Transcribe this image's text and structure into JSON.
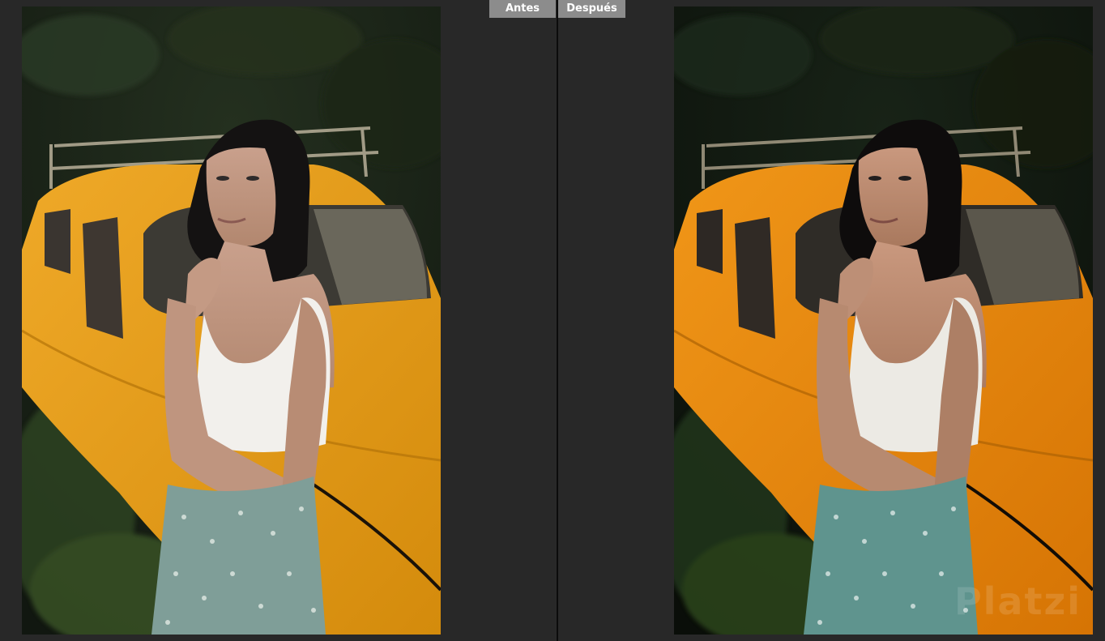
{
  "compare": {
    "before_label": "Antes",
    "after_label": "Después"
  },
  "images": {
    "before": {
      "subject": "woman-leaning-on-yellow-car-photo",
      "car_color": "#e8a21a",
      "top_color": "#f2f0ec",
      "skirt_color": "#7f9e98",
      "hair_color": "#141212",
      "background_color": "#1d261c"
    },
    "after": {
      "subject": "woman-leaning-on-yellow-car-photo-edited",
      "car_color": "#e9860a",
      "top_color": "#eceae4",
      "skirt_color": "#5f948e",
      "hair_color": "#0e0c0c",
      "background_color": "#121912",
      "watermark": "Platzi"
    }
  }
}
